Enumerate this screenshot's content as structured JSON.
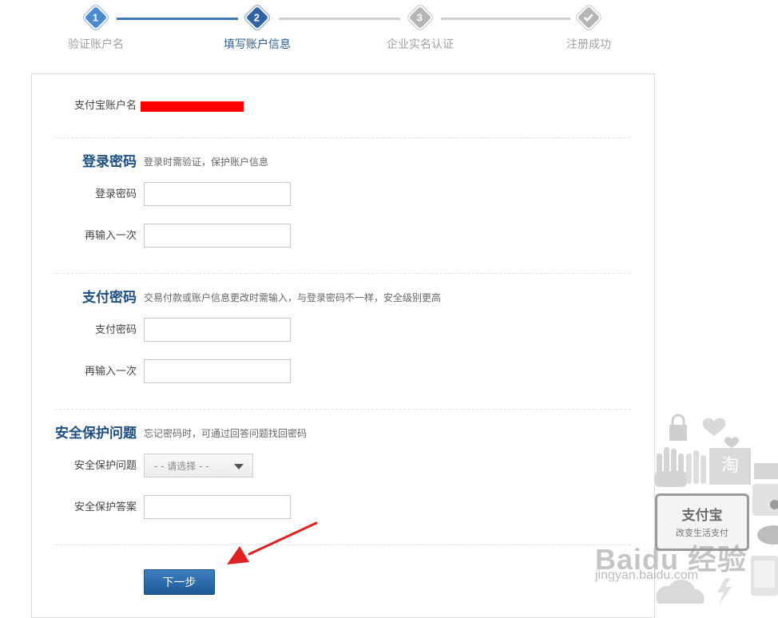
{
  "steps": [
    {
      "number": "1",
      "label": "验证账户名",
      "state": "done"
    },
    {
      "number": "2",
      "label": "填写账户信息",
      "state": "active"
    },
    {
      "number": "3",
      "label": "企业实名认证",
      "state": "todo"
    },
    {
      "number": "",
      "label": "注册成功",
      "state": "todo",
      "icon": "check-icon"
    }
  ],
  "account": {
    "label": "支付宝账户名",
    "value_redacted": true,
    "redaction_color": "#ff0000"
  },
  "login_section": {
    "title": "登录密码",
    "description": "登录时需验证，保护账户信息",
    "password_label": "登录密码",
    "confirm_label": "再输入一次"
  },
  "pay_section": {
    "title": "支付密码",
    "description": "交易付款或账户信息更改时需输入，与登录密码不一样，安全级别更高",
    "password_label": "支付密码",
    "confirm_label": "再输入一次"
  },
  "security_section": {
    "title": "安全保护问题",
    "description": "忘记密码时，可通过回答问题找回密码",
    "question_label": "安全保护问题",
    "question_selected": "- - 请选择 - -",
    "answer_label": "安全保护答案"
  },
  "next_button": "下一步",
  "decor": {
    "promo_brand": "支付宝",
    "promo_slogan": "改变生活支付",
    "taobao_char": "淘",
    "watermark": "Baidu 经验",
    "watermark_url": "jingyan.baidu.com"
  },
  "colors": {
    "accent": "#2e63a6",
    "section_title": "#1d4f82",
    "annotation_arrow": "#e02020"
  }
}
